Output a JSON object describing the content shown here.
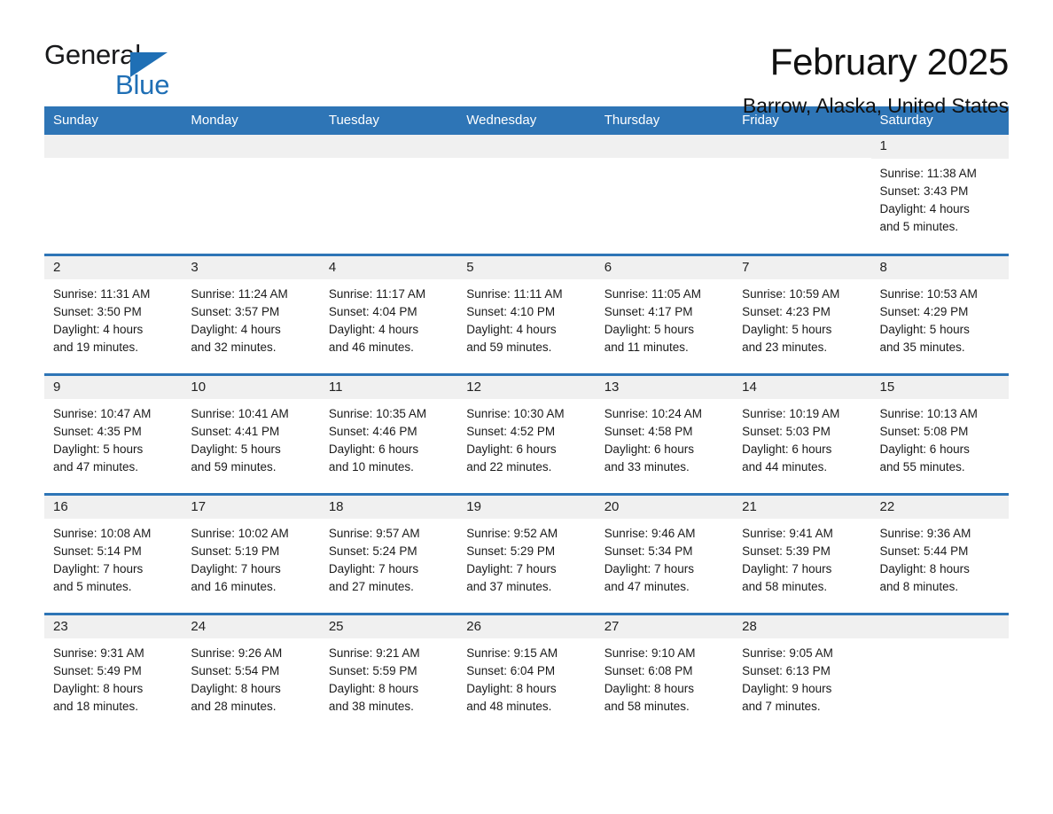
{
  "brand": {
    "name_part1": "General",
    "name_part2": "Blue",
    "accent_color": "#1F6FB5",
    "triangle_icon": "logo-triangle-icon"
  },
  "header": {
    "month_title": "February 2025",
    "location": "Barrow, Alaska, United States"
  },
  "theme": {
    "header_blue": "#2E75B6",
    "daynum_band": "#F0F0F0",
    "text": "#1a1a1a"
  },
  "weekday_headers": [
    "Sunday",
    "Monday",
    "Tuesday",
    "Wednesday",
    "Thursday",
    "Friday",
    "Saturday"
  ],
  "weeks": [
    [
      {
        "day": "",
        "blank": true
      },
      {
        "day": "",
        "blank": true
      },
      {
        "day": "",
        "blank": true
      },
      {
        "day": "",
        "blank": true
      },
      {
        "day": "",
        "blank": true
      },
      {
        "day": "",
        "blank": true
      },
      {
        "day": "1",
        "sunrise": "Sunrise: 11:38 AM",
        "sunset": "Sunset: 3:43 PM",
        "daylight_1": "Daylight: 4 hours",
        "daylight_2": "and 5 minutes."
      }
    ],
    [
      {
        "day": "2",
        "sunrise": "Sunrise: 11:31 AM",
        "sunset": "Sunset: 3:50 PM",
        "daylight_1": "Daylight: 4 hours",
        "daylight_2": "and 19 minutes."
      },
      {
        "day": "3",
        "sunrise": "Sunrise: 11:24 AM",
        "sunset": "Sunset: 3:57 PM",
        "daylight_1": "Daylight: 4 hours",
        "daylight_2": "and 32 minutes."
      },
      {
        "day": "4",
        "sunrise": "Sunrise: 11:17 AM",
        "sunset": "Sunset: 4:04 PM",
        "daylight_1": "Daylight: 4 hours",
        "daylight_2": "and 46 minutes."
      },
      {
        "day": "5",
        "sunrise": "Sunrise: 11:11 AM",
        "sunset": "Sunset: 4:10 PM",
        "daylight_1": "Daylight: 4 hours",
        "daylight_2": "and 59 minutes."
      },
      {
        "day": "6",
        "sunrise": "Sunrise: 11:05 AM",
        "sunset": "Sunset: 4:17 PM",
        "daylight_1": "Daylight: 5 hours",
        "daylight_2": "and 11 minutes."
      },
      {
        "day": "7",
        "sunrise": "Sunrise: 10:59 AM",
        "sunset": "Sunset: 4:23 PM",
        "daylight_1": "Daylight: 5 hours",
        "daylight_2": "and 23 minutes."
      },
      {
        "day": "8",
        "sunrise": "Sunrise: 10:53 AM",
        "sunset": "Sunset: 4:29 PM",
        "daylight_1": "Daylight: 5 hours",
        "daylight_2": "and 35 minutes."
      }
    ],
    [
      {
        "day": "9",
        "sunrise": "Sunrise: 10:47 AM",
        "sunset": "Sunset: 4:35 PM",
        "daylight_1": "Daylight: 5 hours",
        "daylight_2": "and 47 minutes."
      },
      {
        "day": "10",
        "sunrise": "Sunrise: 10:41 AM",
        "sunset": "Sunset: 4:41 PM",
        "daylight_1": "Daylight: 5 hours",
        "daylight_2": "and 59 minutes."
      },
      {
        "day": "11",
        "sunrise": "Sunrise: 10:35 AM",
        "sunset": "Sunset: 4:46 PM",
        "daylight_1": "Daylight: 6 hours",
        "daylight_2": "and 10 minutes."
      },
      {
        "day": "12",
        "sunrise": "Sunrise: 10:30 AM",
        "sunset": "Sunset: 4:52 PM",
        "daylight_1": "Daylight: 6 hours",
        "daylight_2": "and 22 minutes."
      },
      {
        "day": "13",
        "sunrise": "Sunrise: 10:24 AM",
        "sunset": "Sunset: 4:58 PM",
        "daylight_1": "Daylight: 6 hours",
        "daylight_2": "and 33 minutes."
      },
      {
        "day": "14",
        "sunrise": "Sunrise: 10:19 AM",
        "sunset": "Sunset: 5:03 PM",
        "daylight_1": "Daylight: 6 hours",
        "daylight_2": "and 44 minutes."
      },
      {
        "day": "15",
        "sunrise": "Sunrise: 10:13 AM",
        "sunset": "Sunset: 5:08 PM",
        "daylight_1": "Daylight: 6 hours",
        "daylight_2": "and 55 minutes."
      }
    ],
    [
      {
        "day": "16",
        "sunrise": "Sunrise: 10:08 AM",
        "sunset": "Sunset: 5:14 PM",
        "daylight_1": "Daylight: 7 hours",
        "daylight_2": "and 5 minutes."
      },
      {
        "day": "17",
        "sunrise": "Sunrise: 10:02 AM",
        "sunset": "Sunset: 5:19 PM",
        "daylight_1": "Daylight: 7 hours",
        "daylight_2": "and 16 minutes."
      },
      {
        "day": "18",
        "sunrise": "Sunrise: 9:57 AM",
        "sunset": "Sunset: 5:24 PM",
        "daylight_1": "Daylight: 7 hours",
        "daylight_2": "and 27 minutes."
      },
      {
        "day": "19",
        "sunrise": "Sunrise: 9:52 AM",
        "sunset": "Sunset: 5:29 PM",
        "daylight_1": "Daylight: 7 hours",
        "daylight_2": "and 37 minutes."
      },
      {
        "day": "20",
        "sunrise": "Sunrise: 9:46 AM",
        "sunset": "Sunset: 5:34 PM",
        "daylight_1": "Daylight: 7 hours",
        "daylight_2": "and 47 minutes."
      },
      {
        "day": "21",
        "sunrise": "Sunrise: 9:41 AM",
        "sunset": "Sunset: 5:39 PM",
        "daylight_1": "Daylight: 7 hours",
        "daylight_2": "and 58 minutes."
      },
      {
        "day": "22",
        "sunrise": "Sunrise: 9:36 AM",
        "sunset": "Sunset: 5:44 PM",
        "daylight_1": "Daylight: 8 hours",
        "daylight_2": "and 8 minutes."
      }
    ],
    [
      {
        "day": "23",
        "sunrise": "Sunrise: 9:31 AM",
        "sunset": "Sunset: 5:49 PM",
        "daylight_1": "Daylight: 8 hours",
        "daylight_2": "and 18 minutes."
      },
      {
        "day": "24",
        "sunrise": "Sunrise: 9:26 AM",
        "sunset": "Sunset: 5:54 PM",
        "daylight_1": "Daylight: 8 hours",
        "daylight_2": "and 28 minutes."
      },
      {
        "day": "25",
        "sunrise": "Sunrise: 9:21 AM",
        "sunset": "Sunset: 5:59 PM",
        "daylight_1": "Daylight: 8 hours",
        "daylight_2": "and 38 minutes."
      },
      {
        "day": "26",
        "sunrise": "Sunrise: 9:15 AM",
        "sunset": "Sunset: 6:04 PM",
        "daylight_1": "Daylight: 8 hours",
        "daylight_2": "and 48 minutes."
      },
      {
        "day": "27",
        "sunrise": "Sunrise: 9:10 AM",
        "sunset": "Sunset: 6:08 PM",
        "daylight_1": "Daylight: 8 hours",
        "daylight_2": "and 58 minutes."
      },
      {
        "day": "28",
        "sunrise": "Sunrise: 9:05 AM",
        "sunset": "Sunset: 6:13 PM",
        "daylight_1": "Daylight: 9 hours",
        "daylight_2": "and 7 minutes."
      },
      {
        "day": "",
        "blank": true
      }
    ]
  ]
}
